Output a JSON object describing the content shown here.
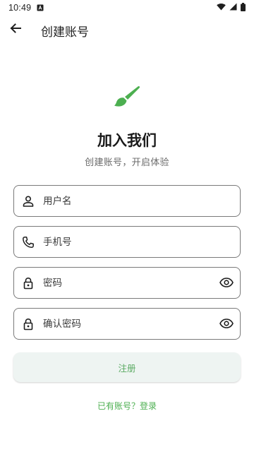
{
  "status_bar": {
    "time": "10:49",
    "notification_icon": "a-icon",
    "wifi_icon": "wifi-icon",
    "signal_icon": "signal-icon",
    "battery_icon": "battery-icon"
  },
  "app_bar": {
    "back_icon": "arrow-back-icon",
    "title": "创建账号"
  },
  "hero": {
    "icon": "paint-brush-icon",
    "icon_color": "#4caf50",
    "title": "加入我们",
    "subtitle": "创建账号，开启体验"
  },
  "form": {
    "username": {
      "placeholder": "用户名",
      "value": "",
      "icon": "person-icon"
    },
    "phone": {
      "placeholder": "手机号",
      "value": "",
      "icon": "phone-icon"
    },
    "password": {
      "placeholder": "密码",
      "value": "",
      "icon": "lock-icon",
      "toggle_icon": "eye-icon"
    },
    "confirm_password": {
      "placeholder": "确认密码",
      "value": "",
      "icon": "lock-icon",
      "toggle_icon": "eye-icon"
    }
  },
  "actions": {
    "register_label": "注册",
    "login_link": "已有账号？登录"
  },
  "colors": {
    "accent": "#4caf50",
    "button_bg": "#eef4f2",
    "border": "#7a7a7a"
  }
}
